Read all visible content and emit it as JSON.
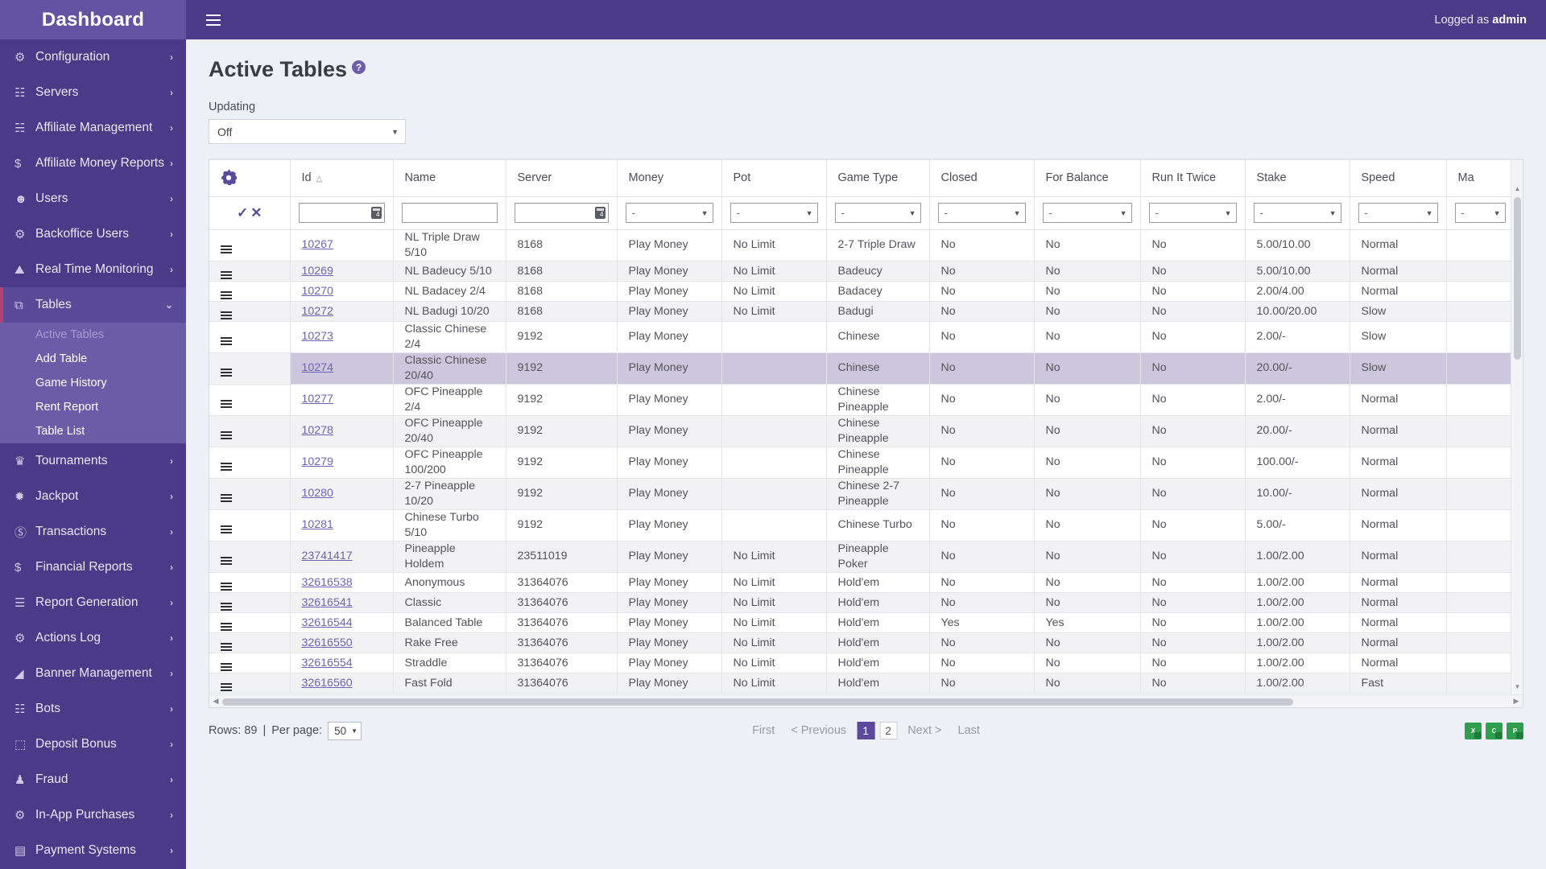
{
  "topbar": {
    "brand": "Dashboard",
    "menu_icon": "hamburger-icon",
    "logged_prefix": "Logged as ",
    "logged_user": "admin"
  },
  "sidebar": {
    "items": [
      {
        "label": "Configuration",
        "icon": "gear-icon",
        "chevron": "›"
      },
      {
        "label": "Servers",
        "icon": "server-icon",
        "chevron": "›"
      },
      {
        "label": "Affiliate Management",
        "icon": "affiliate-icon",
        "chevron": "›"
      },
      {
        "label": "Affiliate Money Reports",
        "icon": "money-report-icon",
        "chevron": "›"
      },
      {
        "label": "Users",
        "icon": "users-icon",
        "chevron": "›"
      },
      {
        "label": "Backoffice Users",
        "icon": "gear-icon",
        "chevron": "›"
      },
      {
        "label": "Real Time Monitoring",
        "icon": "monitor-icon",
        "chevron": "›"
      },
      {
        "label": "Tables",
        "icon": "tables-icon",
        "chevron": "⌄",
        "open": true
      },
      {
        "label": "Tournaments",
        "icon": "trophy-icon",
        "chevron": "›"
      },
      {
        "label": "Jackpot",
        "icon": "jackpot-icon",
        "chevron": "›"
      },
      {
        "label": "Transactions",
        "icon": "transactions-icon",
        "chevron": "›"
      },
      {
        "label": "Financial Reports",
        "icon": "money-report-icon",
        "chevron": "›"
      },
      {
        "label": "Report Generation",
        "icon": "report-icon",
        "chevron": "›"
      },
      {
        "label": "Actions Log",
        "icon": "gear-icon",
        "chevron": "›"
      },
      {
        "label": "Banner Management",
        "icon": "banner-icon",
        "chevron": "›"
      },
      {
        "label": "Bots",
        "icon": "robot-icon",
        "chevron": "›"
      },
      {
        "label": "Deposit Bonus",
        "icon": "gift-icon",
        "chevron": "›"
      },
      {
        "label": "Fraud",
        "icon": "fraud-icon",
        "chevron": "›"
      },
      {
        "label": "In-App Purchases",
        "icon": "gear-icon",
        "chevron": "›"
      },
      {
        "label": "Payment Systems",
        "icon": "card-icon",
        "chevron": "›"
      }
    ],
    "submenu": [
      {
        "label": "Active Tables",
        "active": true
      },
      {
        "label": "Add Table",
        "active": false
      },
      {
        "label": "Game History",
        "active": false
      },
      {
        "label": "Rent Report",
        "active": false
      },
      {
        "label": "Table List",
        "active": false
      }
    ]
  },
  "page": {
    "title": "Active Tables",
    "help_icon": "?",
    "updating_label": "Updating",
    "updating_value": "Off"
  },
  "grid": {
    "settings_icon": "gear-icon",
    "filter_apply_icon": "✓",
    "filter_clear_icon": "✕",
    "columns": [
      {
        "key": "actions",
        "label": "",
        "cls": "col-act"
      },
      {
        "key": "id",
        "label": "Id",
        "sort": "△",
        "cls": "col-id"
      },
      {
        "key": "name",
        "label": "Name",
        "cls": "col-name"
      },
      {
        "key": "server",
        "label": "Server",
        "cls": "col-server"
      },
      {
        "key": "money",
        "label": "Money",
        "cls": "col-money"
      },
      {
        "key": "pot",
        "label": "Pot",
        "cls": "col-pot"
      },
      {
        "key": "gametype",
        "label": "Game Type",
        "cls": "col-gtype"
      },
      {
        "key": "closed",
        "label": "Closed",
        "cls": "col-closed"
      },
      {
        "key": "forbalance",
        "label": "For Balance",
        "cls": "col-forbal"
      },
      {
        "key": "runittwice",
        "label": "Run It Twice",
        "cls": "col-riit"
      },
      {
        "key": "stake",
        "label": "Stake",
        "cls": "col-stake"
      },
      {
        "key": "speed",
        "label": "Speed",
        "cls": "col-speed"
      },
      {
        "key": "max",
        "label": "Ma",
        "cls": "col-max"
      }
    ],
    "filters": {
      "id": "",
      "name": "",
      "server": "",
      "money": "-",
      "pot": "-",
      "gametype": "-",
      "closed": "-",
      "forbalance": "-",
      "runittwice": "-",
      "stake": "-",
      "speed": "-",
      "max": "-"
    },
    "rows": [
      {
        "id": "10267",
        "name": "NL Triple Draw 5/10",
        "server": "8168",
        "money": "Play Money",
        "pot": "No Limit",
        "gametype": "2-7 Triple Draw",
        "closed": "No",
        "forbalance": "No",
        "runittwice": "No",
        "stake": "5.00/10.00",
        "speed": "Normal",
        "tall": true
      },
      {
        "id": "10269",
        "name": "NL Badeucy 5/10",
        "server": "8168",
        "money": "Play Money",
        "pot": "No Limit",
        "gametype": "Badeucy",
        "closed": "No",
        "forbalance": "No",
        "runittwice": "No",
        "stake": "5.00/10.00",
        "speed": "Normal"
      },
      {
        "id": "10270",
        "name": "NL Badacey 2/4",
        "server": "8168",
        "money": "Play Money",
        "pot": "No Limit",
        "gametype": "Badacey",
        "closed": "No",
        "forbalance": "No",
        "runittwice": "No",
        "stake": "2.00/4.00",
        "speed": "Normal"
      },
      {
        "id": "10272",
        "name": "NL Badugi 10/20",
        "server": "8168",
        "money": "Play Money",
        "pot": "No Limit",
        "gametype": "Badugi",
        "closed": "No",
        "forbalance": "No",
        "runittwice": "No",
        "stake": "10.00/20.00",
        "speed": "Slow"
      },
      {
        "id": "10273",
        "name": "Classic Chinese 2/4",
        "server": "9192",
        "money": "Play Money",
        "pot": "",
        "gametype": "Chinese",
        "closed": "No",
        "forbalance": "No",
        "runittwice": "No",
        "stake": "2.00/-",
        "speed": "Slow",
        "tall": true
      },
      {
        "id": "10274",
        "name": "Classic Chinese 20/40",
        "server": "9192",
        "money": "Play Money",
        "pot": "",
        "gametype": "Chinese",
        "closed": "No",
        "forbalance": "No",
        "runittwice": "No",
        "stake": "20.00/-",
        "speed": "Slow",
        "tall": true,
        "selected": true
      },
      {
        "id": "10277",
        "name": "OFC Pineapple 2/4",
        "server": "9192",
        "money": "Play Money",
        "pot": "",
        "gametype": "Chinese Pineapple",
        "closed": "No",
        "forbalance": "No",
        "runittwice": "No",
        "stake": "2.00/-",
        "speed": "Normal",
        "tall": true
      },
      {
        "id": "10278",
        "name": "OFC Pineapple 20/40",
        "server": "9192",
        "money": "Play Money",
        "pot": "",
        "gametype": "Chinese Pineapple",
        "closed": "No",
        "forbalance": "No",
        "runittwice": "No",
        "stake": "20.00/-",
        "speed": "Normal",
        "tall": true
      },
      {
        "id": "10279",
        "name": "OFC Pineapple 100/200",
        "server": "9192",
        "money": "Play Money",
        "pot": "",
        "gametype": "Chinese Pineapple",
        "closed": "No",
        "forbalance": "No",
        "runittwice": "No",
        "stake": "100.00/-",
        "speed": "Normal",
        "tall": true
      },
      {
        "id": "10280",
        "name": "2-7 Pineapple 10/20",
        "server": "9192",
        "money": "Play Money",
        "pot": "",
        "gametype": "Chinese 2-7 Pineapple",
        "closed": "No",
        "forbalance": "No",
        "runittwice": "No",
        "stake": "10.00/-",
        "speed": "Normal",
        "tall": true
      },
      {
        "id": "10281",
        "name": "Chinese Turbo 5/10",
        "server": "9192",
        "money": "Play Money",
        "pot": "",
        "gametype": "Chinese Turbo",
        "closed": "No",
        "forbalance": "No",
        "runittwice": "No",
        "stake": "5.00/-",
        "speed": "Normal",
        "tall": true
      },
      {
        "id": "23741417",
        "name": "Pineapple Holdem",
        "server": "23511019",
        "money": "Play Money",
        "pot": "No Limit",
        "gametype": "Pineapple Poker",
        "closed": "No",
        "forbalance": "No",
        "runittwice": "No",
        "stake": "1.00/2.00",
        "speed": "Normal",
        "tall": true
      },
      {
        "id": "32616538",
        "name": "Anonymous",
        "server": "31364076",
        "money": "Play Money",
        "pot": "No Limit",
        "gametype": "Hold'em",
        "closed": "No",
        "forbalance": "No",
        "runittwice": "No",
        "stake": "1.00/2.00",
        "speed": "Normal"
      },
      {
        "id": "32616541",
        "name": "Classic",
        "server": "31364076",
        "money": "Play Money",
        "pot": "No Limit",
        "gametype": "Hold'em",
        "closed": "No",
        "forbalance": "No",
        "runittwice": "No",
        "stake": "1.00/2.00",
        "speed": "Normal"
      },
      {
        "id": "32616544",
        "name": "Balanced Table",
        "server": "31364076",
        "money": "Play Money",
        "pot": "No Limit",
        "gametype": "Hold'em",
        "closed": "Yes",
        "forbalance": "Yes",
        "runittwice": "No",
        "stake": "1.00/2.00",
        "speed": "Normal"
      },
      {
        "id": "32616550",
        "name": "Rake Free",
        "server": "31364076",
        "money": "Play Money",
        "pot": "No Limit",
        "gametype": "Hold'em",
        "closed": "No",
        "forbalance": "No",
        "runittwice": "No",
        "stake": "1.00/2.00",
        "speed": "Normal"
      },
      {
        "id": "32616554",
        "name": "Straddle",
        "server": "31364076",
        "money": "Play Money",
        "pot": "No Limit",
        "gametype": "Hold'em",
        "closed": "No",
        "forbalance": "No",
        "runittwice": "No",
        "stake": "1.00/2.00",
        "speed": "Normal"
      },
      {
        "id": "32616560",
        "name": "Fast Fold",
        "server": "31364076",
        "money": "Play Money",
        "pot": "No Limit",
        "gametype": "Hold'em",
        "closed": "No",
        "forbalance": "No",
        "runittwice": "No",
        "stake": "1.00/2.00",
        "speed": "Fast"
      }
    ]
  },
  "footer": {
    "rows_label": "Rows: 89",
    "separator": "|",
    "perpage_label": "Per page:",
    "perpage_value": "50",
    "pager": {
      "first": "First",
      "previous": "< Previous",
      "pages": [
        "1",
        "2"
      ],
      "active_page": "1",
      "next": "Next >",
      "last": "Last"
    },
    "exports": [
      {
        "name": "export-excel-icon",
        "label": "X"
      },
      {
        "name": "export-csv-icon",
        "label": "C"
      },
      {
        "name": "export-pdf-icon",
        "label": "P"
      }
    ]
  },
  "colors": {
    "brand_purple": "#4a3a87",
    "brand_light": "#6254a0",
    "accent_pink": "#b4417a",
    "link": "#6f63b4",
    "selection": "#ccc7dd",
    "page_bg": "#edf0f5"
  }
}
